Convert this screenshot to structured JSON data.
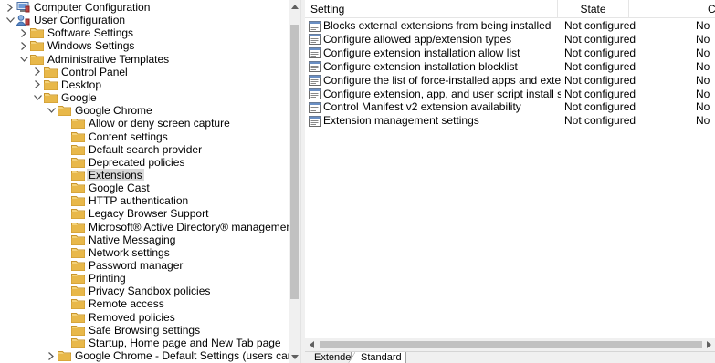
{
  "tree": {
    "items": [
      {
        "label": "Computer Configuration",
        "expander": "collapsed",
        "icon": "computer-config-icon",
        "depth": 0
      },
      {
        "label": "User Configuration",
        "expander": "expanded",
        "icon": "user-config-icon",
        "depth": 0
      },
      {
        "label": "Software Settings",
        "expander": "collapsed",
        "icon": "folder-icon",
        "depth": 1
      },
      {
        "label": "Windows Settings",
        "expander": "collapsed",
        "icon": "folder-icon",
        "depth": 1
      },
      {
        "label": "Administrative Templates",
        "expander": "expanded",
        "icon": "folder-icon",
        "depth": 1
      },
      {
        "label": "Control Panel",
        "expander": "collapsed",
        "icon": "folder-icon",
        "depth": 2
      },
      {
        "label": "Desktop",
        "expander": "collapsed",
        "icon": "folder-icon",
        "depth": 2
      },
      {
        "label": "Google",
        "expander": "expanded",
        "icon": "folder-icon",
        "depth": 2
      },
      {
        "label": "Google Chrome",
        "expander": "expanded",
        "icon": "folder-icon",
        "depth": 3
      },
      {
        "label": "Allow or deny screen capture",
        "expander": "none",
        "icon": "folder-icon",
        "depth": 4
      },
      {
        "label": "Content settings",
        "expander": "none",
        "icon": "folder-icon",
        "depth": 4
      },
      {
        "label": "Default search provider",
        "expander": "none",
        "icon": "folder-icon",
        "depth": 4
      },
      {
        "label": "Deprecated policies",
        "expander": "none",
        "icon": "folder-icon",
        "depth": 4
      },
      {
        "label": "Extensions",
        "expander": "none",
        "icon": "folder-icon",
        "depth": 4,
        "selected": true
      },
      {
        "label": "Google Cast",
        "expander": "none",
        "icon": "folder-icon",
        "depth": 4
      },
      {
        "label": "HTTP authentication",
        "expander": "none",
        "icon": "folder-icon",
        "depth": 4
      },
      {
        "label": "Legacy Browser Support",
        "expander": "none",
        "icon": "folder-icon",
        "depth": 4
      },
      {
        "label": "Microsoft® Active Directory® management settings",
        "expander": "none",
        "icon": "folder-icon",
        "depth": 4
      },
      {
        "label": "Native Messaging",
        "expander": "none",
        "icon": "folder-icon",
        "depth": 4
      },
      {
        "label": "Network settings",
        "expander": "none",
        "icon": "folder-icon",
        "depth": 4
      },
      {
        "label": "Password manager",
        "expander": "none",
        "icon": "folder-icon",
        "depth": 4
      },
      {
        "label": "Printing",
        "expander": "none",
        "icon": "folder-icon",
        "depth": 4
      },
      {
        "label": "Privacy Sandbox policies",
        "expander": "none",
        "icon": "folder-icon",
        "depth": 4
      },
      {
        "label": "Remote access",
        "expander": "none",
        "icon": "folder-icon",
        "depth": 4
      },
      {
        "label": "Removed policies",
        "expander": "none",
        "icon": "folder-icon",
        "depth": 4
      },
      {
        "label": "Safe Browsing settings",
        "expander": "none",
        "icon": "folder-icon",
        "depth": 4
      },
      {
        "label": "Startup, Home page and New Tab page",
        "expander": "none",
        "icon": "folder-icon",
        "depth": 4
      },
      {
        "label": "Google Chrome - Default Settings (users can override)",
        "expander": "collapsed",
        "icon": "folder-icon",
        "depth": 3
      }
    ]
  },
  "list": {
    "columns": {
      "setting": "Setting",
      "state": "State",
      "comment": "Comme"
    },
    "rows": [
      {
        "setting": "Blocks external extensions from being installed",
        "state": "Not configured",
        "comment": "No"
      },
      {
        "setting": "Configure allowed app/extension types",
        "state": "Not configured",
        "comment": "No"
      },
      {
        "setting": "Configure extension installation allow list",
        "state": "Not configured",
        "comment": "No"
      },
      {
        "setting": "Configure extension installation blocklist",
        "state": "Not configured",
        "comment": "No"
      },
      {
        "setting": "Configure the list of force-installed apps and extensions",
        "state": "Not configured",
        "comment": "No"
      },
      {
        "setting": "Configure extension, app, and user script install sources",
        "state": "Not configured",
        "comment": "No"
      },
      {
        "setting": "Control Manifest v2 extension availability",
        "state": "Not configured",
        "comment": "No"
      },
      {
        "setting": "Extension management settings",
        "state": "Not configured",
        "comment": "No"
      }
    ]
  },
  "tabs": {
    "extended": "Extended",
    "standard": "Standard"
  },
  "colors": {
    "folder": "#e8b84a",
    "folder_dark": "#c9952b",
    "selected_bg": "#d9d9d9",
    "scroll_bg": "#f0f0f0",
    "scroll_thumb": "#c1c1c1"
  }
}
